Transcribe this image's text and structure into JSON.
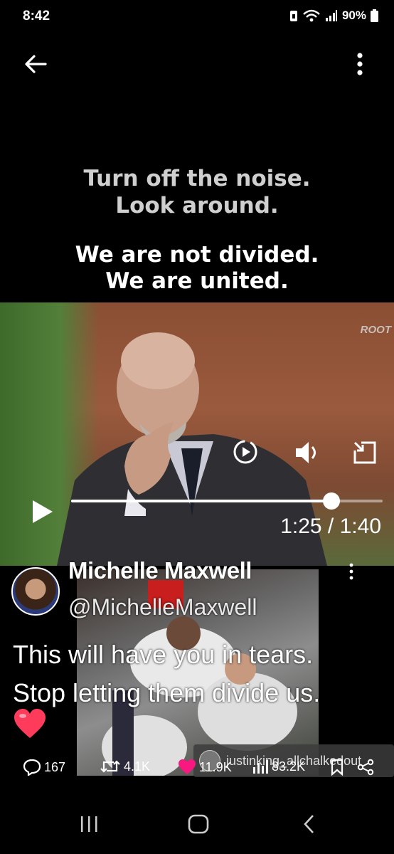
{
  "status_bar": {
    "time": "8:42",
    "battery": "90%"
  },
  "video": {
    "caption_line1": "Turn off the noise.",
    "caption_line2": "Look around.",
    "caption_line3": "We are not divided.",
    "caption_line4": "We are united.",
    "watermark": "ROOT",
    "current_time": "1:25",
    "separator": "/",
    "duration": "1:40",
    "progress": 0.835
  },
  "tweet": {
    "author_name": "Michelle Maxwell",
    "author_handle": "@MichelleMaxwell",
    "text_line1": "This will have you in tears.",
    "text_line2": "Stop letting them divide us.",
    "attribution": "justinking_allchalkedout"
  },
  "actions": {
    "replies": "167",
    "reposts": "4.1K",
    "likes": "11.9K",
    "views": "83.2K"
  },
  "colors": {
    "like_accent": "#f91880",
    "background": "#000000"
  },
  "icons": [
    "back-arrow-icon",
    "more-vertical-icon",
    "replay-icon",
    "volume-icon",
    "pip-icon",
    "play-icon",
    "reply-icon",
    "repost-icon",
    "heart-icon",
    "views-icon",
    "bookmark-icon",
    "share-icon",
    "recent-apps-icon",
    "home-icon",
    "nav-back-icon"
  ]
}
